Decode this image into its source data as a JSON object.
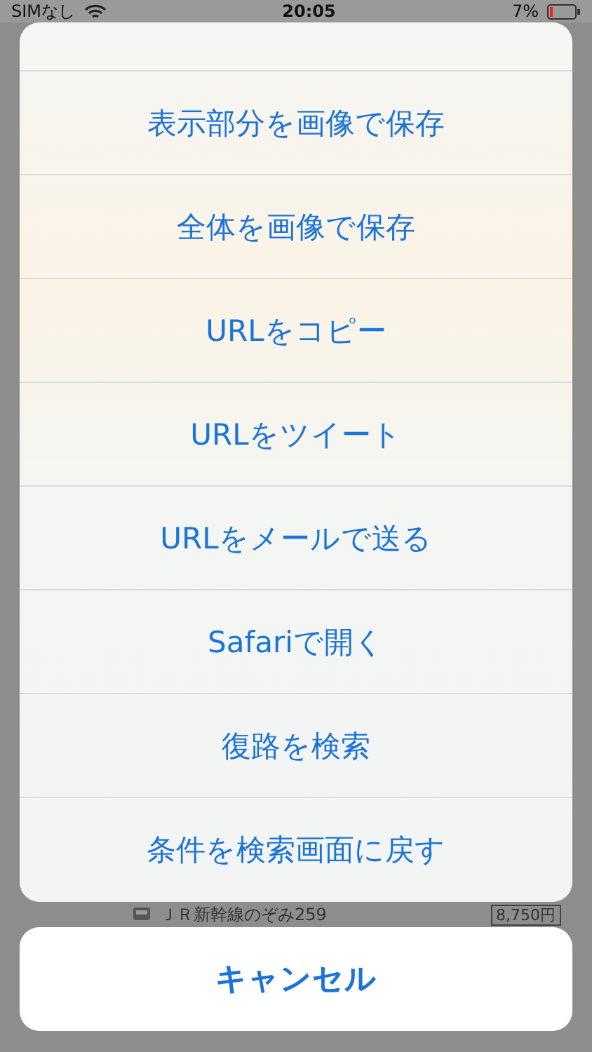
{
  "status_bar": {
    "carrier": "SIMなし",
    "time": "20:05",
    "battery": "7%"
  },
  "actions": [
    {
      "label": "表示部分を画像で保存"
    },
    {
      "label": "全体を画像で保存"
    },
    {
      "label": "URLをコピー"
    },
    {
      "label": "URLをツイート"
    },
    {
      "label": "URLをメールで送る"
    },
    {
      "label": "Safariで開く"
    },
    {
      "label": "復路を検索"
    },
    {
      "label": "条件を検索画面に戻す"
    }
  ],
  "background_row": {
    "train": "ＪＲ新幹線のぞみ259",
    "fare": "8,750円"
  },
  "cancel": "キャンセル"
}
